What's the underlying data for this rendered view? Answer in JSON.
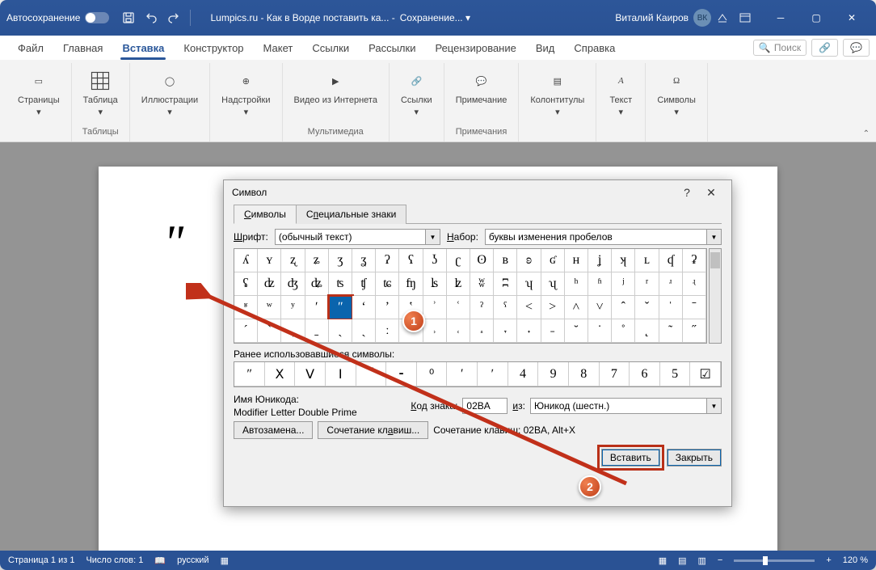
{
  "titlebar": {
    "autosave_label": "Автосохранение",
    "doc_title": "Lumpics.ru - Как в Ворде поставить ка... -",
    "save_status": "Сохранение... ▾",
    "user_name": "Виталий Каиров",
    "user_initials": "ВК"
  },
  "menu": {
    "tabs": [
      "Файл",
      "Главная",
      "Вставка",
      "Конструктор",
      "Макет",
      "Ссылки",
      "Рассылки",
      "Рецензирование",
      "Вид",
      "Справка"
    ],
    "active_index": 2,
    "search_placeholder": "Поиск"
  },
  "ribbon": {
    "groups": [
      {
        "label": "",
        "items": [
          {
            "label": "Страницы",
            "dropdown": true
          }
        ]
      },
      {
        "label": "Таблицы",
        "items": [
          {
            "label": "Таблица",
            "dropdown": true
          }
        ]
      },
      {
        "label": "",
        "items": [
          {
            "label": "Иллюстрации",
            "dropdown": true
          }
        ]
      },
      {
        "label": "",
        "items": [
          {
            "label": "Надстройки",
            "dropdown": true
          }
        ]
      },
      {
        "label": "Мультимедиа",
        "items": [
          {
            "label": "Видео из Интернета"
          }
        ]
      },
      {
        "label": "",
        "items": [
          {
            "label": "Ссылки",
            "dropdown": true
          }
        ]
      },
      {
        "label": "Примечания",
        "items": [
          {
            "label": "Примечание"
          }
        ]
      },
      {
        "label": "",
        "items": [
          {
            "label": "Колонтитулы",
            "dropdown": true
          }
        ]
      },
      {
        "label": "",
        "items": [
          {
            "label": "Текст",
            "dropdown": true
          }
        ]
      },
      {
        "label": "",
        "items": [
          {
            "label": "Символы",
            "dropdown": true
          }
        ]
      }
    ]
  },
  "document": {
    "big_char": "ʺ"
  },
  "dialog": {
    "title": "Символ",
    "tabs": [
      "Символы",
      "Специальные знаки"
    ],
    "active_tab": 0,
    "font_label": "Шрифт:",
    "font_value": "(обычный текст)",
    "set_label": "Набор:",
    "set_value": "буквы изменения пробелов",
    "grid_rows": [
      [
        "ʎ",
        "ʏ",
        "ʐ",
        "ʑ",
        "ʒ",
        "ʓ",
        "ʔ",
        "ʕ",
        "ʖ",
        "ʗ",
        "ʘ",
        "ʙ",
        "ʚ",
        "ʛ",
        "ʜ",
        "ʝ",
        "ʞ",
        "ʟ",
        "ʠ",
        "ʡ"
      ],
      [
        "ʢ",
        "ʣ",
        "ʤ",
        "ʥ",
        "ʦ",
        "ʧ",
        "ʨ",
        "ʩ",
        "ʪ",
        "ʫ",
        "ʬ",
        "ʭ",
        "ʮ",
        "ʯ",
        "ʰ",
        "ʱ",
        "ʲ",
        "ʳ",
        "ʴ",
        "ʵ"
      ],
      [
        "ʶ",
        "ʷ",
        "ʸ",
        "ʹ",
        "ʺ",
        "ʻ",
        "ʼ",
        "ʽ",
        "ʾ",
        "ʿ",
        "ˀ",
        "ˁ",
        "˂",
        "˃",
        "˄",
        "˅",
        "ˆ",
        "ˇ",
        "ˈ",
        "ˉ"
      ],
      [
        "ˊ",
        "ˋ",
        "ˌ",
        "ˍ",
        "ˎ",
        "ˏ",
        "ː",
        "ˑ",
        "˒",
        "˓",
        "˔",
        "˕",
        "˖",
        "˗",
        "˘",
        "˙",
        "˚",
        "˛",
        "˜",
        "˝"
      ]
    ],
    "selected": {
      "row": 2,
      "col": 4
    },
    "recent_label": "Ранее использовавшиеся символы:",
    "recent": [
      "ʺ",
      "Ⅹ",
      "Ⅴ",
      "Ⅰ",
      "‾",
      "⁃",
      "⁰",
      "′",
      "ʹ",
      "4",
      "9",
      "8",
      "7",
      "6",
      "5",
      "☑"
    ],
    "unicode_name_label": "Имя Юникода:",
    "unicode_name": "Modifier Letter Double Prime",
    "code_label": "Код знака:",
    "code_value": "02BA",
    "from_label": "из:",
    "from_value": "Юникод (шестн.)",
    "autocorrect_btn": "Автозамена...",
    "shortcut_btn": "Сочетание клавиш...",
    "shortcut_label": "Сочетание клавиш: 02BA, Alt+X",
    "insert_btn": "Вставить",
    "close_btn": "Закрыть"
  },
  "callouts": {
    "one": "1",
    "two": "2"
  },
  "statusbar": {
    "page": "Страница 1 из 1",
    "words": "Число слов: 1",
    "lang": "русский",
    "zoom": "120 %"
  }
}
